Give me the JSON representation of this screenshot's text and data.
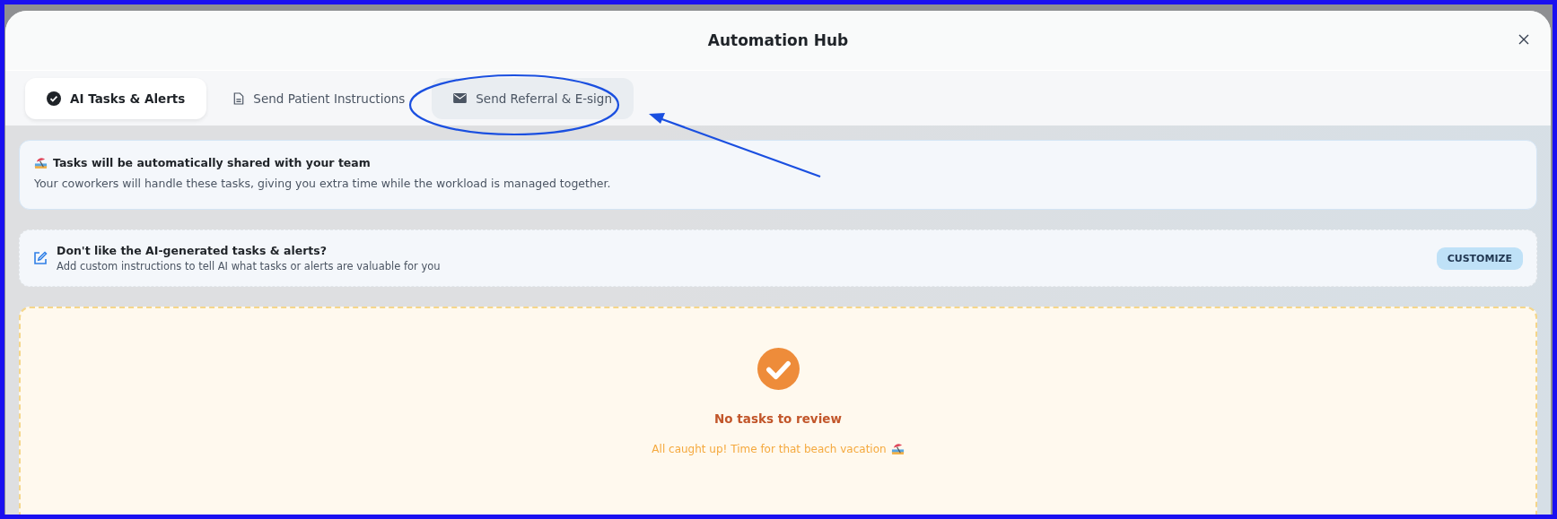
{
  "dialog": {
    "title": "Automation Hub"
  },
  "tabs": [
    {
      "label": "AI Tasks & Alerts",
      "kind": "check",
      "selected": true,
      "hovered": false
    },
    {
      "label": "Send Patient Instructions",
      "kind": "document",
      "selected": false,
      "hovered": false
    },
    {
      "label": "Send Referral & E-sign",
      "kind": "mail",
      "selected": false,
      "hovered": true
    }
  ],
  "info_banner": {
    "title": "Tasks will be automatically shared with your team",
    "text": "Your coworkers will handle these tasks, giving you extra time while the workload is managed together."
  },
  "customize_banner": {
    "title": "Don't like the AI-generated tasks & alerts?",
    "text": "Add custom instructions to tell AI what tasks or alerts are valuable for you",
    "button": "CUSTOMIZE"
  },
  "empty_state": {
    "title": "No tasks to review",
    "text": "All caught up! Time for that beach vacation"
  }
}
